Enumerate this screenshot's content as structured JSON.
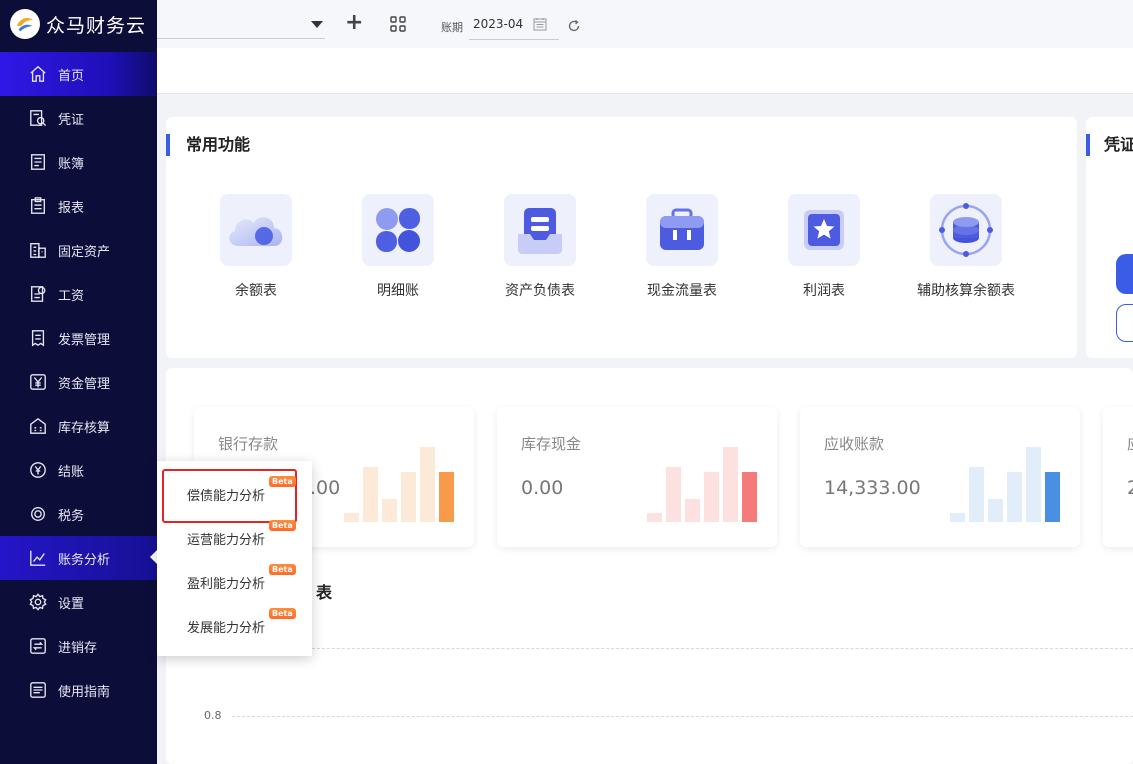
{
  "app": {
    "name": "众马财务云"
  },
  "colors": {
    "sidebar_bg": "#0d0d3a",
    "accent": "#3a5ce6",
    "beta": "#ff7a30",
    "highlight": "#e12525"
  },
  "sidebar": {
    "items": [
      {
        "label": "首页",
        "icon": "home-icon"
      },
      {
        "label": "凭证",
        "icon": "voucher-search-icon"
      },
      {
        "label": "账簿",
        "icon": "ledger-icon"
      },
      {
        "label": "报表",
        "icon": "report-icon"
      },
      {
        "label": "固定资产",
        "icon": "building-icon"
      },
      {
        "label": "工资",
        "icon": "salary-icon"
      },
      {
        "label": "发票管理",
        "icon": "invoice-icon"
      },
      {
        "label": "资金管理",
        "icon": "yen-icon"
      },
      {
        "label": "库存核算",
        "icon": "warehouse-icon"
      },
      {
        "label": "结账",
        "icon": "checkout-icon"
      },
      {
        "label": "税务",
        "icon": "tax-icon"
      },
      {
        "label": "账务分析",
        "icon": "chart-line-icon"
      },
      {
        "label": "设置",
        "icon": "gear-icon"
      },
      {
        "label": "进销存",
        "icon": "inventory-icon"
      },
      {
        "label": "使用指南",
        "icon": "guide-icon"
      }
    ]
  },
  "topbar": {
    "company_value": "",
    "period_label": "账期",
    "period_value": "2023-04"
  },
  "quick_functions": {
    "title": "常用功能",
    "items": [
      {
        "label": "余额表",
        "icon": "cloud-icon"
      },
      {
        "label": "明细账",
        "icon": "clover-icon"
      },
      {
        "label": "资产负债表",
        "icon": "document-tray-icon"
      },
      {
        "label": "现金流量表",
        "icon": "briefcase-icon"
      },
      {
        "label": "利润表",
        "icon": "star-card-icon"
      },
      {
        "label": "辅助核算余额表",
        "icon": "database-icon"
      }
    ]
  },
  "voucher_panel": {
    "title": "凭证"
  },
  "stats": [
    {
      "title": "银行存款",
      "value": ".00",
      "color": "#f79a4b",
      "light": "#fde9d8"
    },
    {
      "title": "库存现金",
      "value": "0.00",
      "color": "#f57b7b",
      "light": "#fde1e1"
    },
    {
      "title": "应收账款",
      "value": "14,333.00",
      "color": "#4a90e2",
      "light": "#e1edf9"
    },
    {
      "title": "应",
      "value": "2",
      "color": "#999999",
      "light": "#eeeeee"
    }
  ],
  "chart": {
    "title": "表",
    "y_label": "0.8"
  },
  "popover": {
    "items": [
      {
        "label": "偿债能力分析",
        "badge": "Beta"
      },
      {
        "label": "运营能力分析",
        "badge": "Beta"
      },
      {
        "label": "盈利能力分析",
        "badge": "Beta"
      },
      {
        "label": "发展能力分析",
        "badge": "Beta"
      }
    ]
  }
}
